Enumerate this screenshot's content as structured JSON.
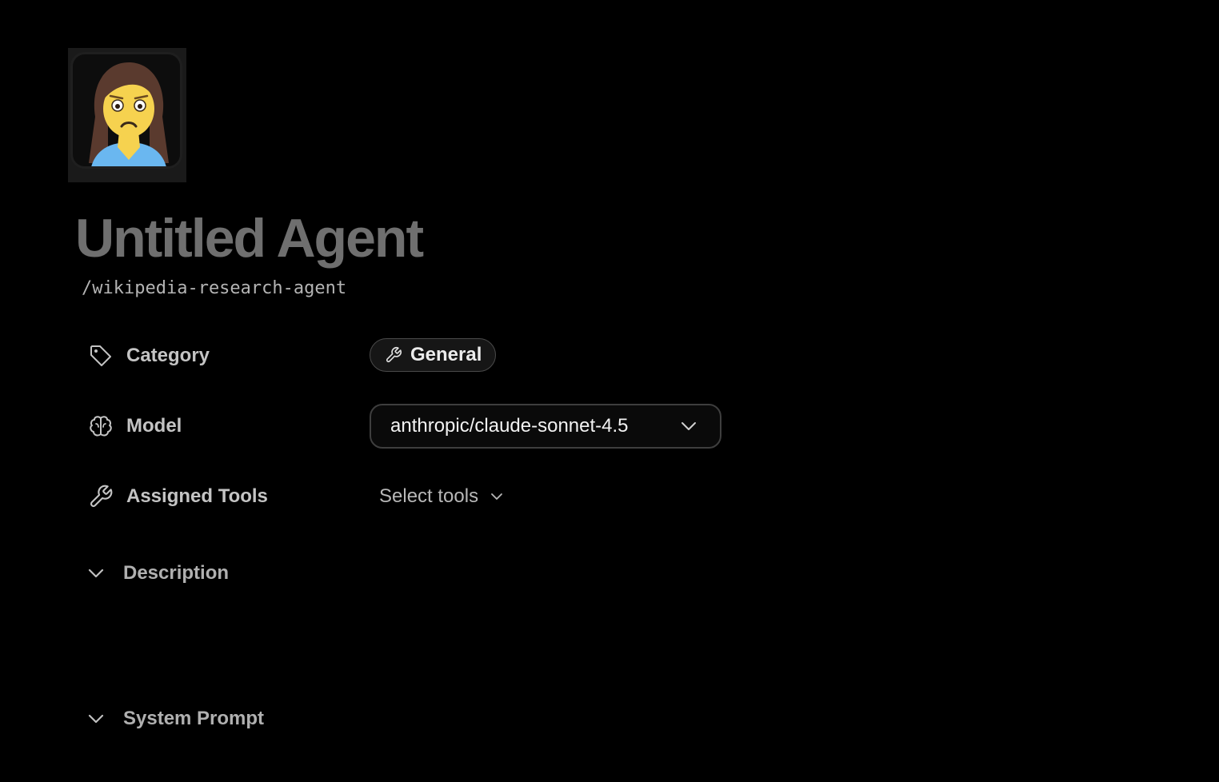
{
  "agent": {
    "name": "Untitled Agent",
    "slug": "/wikipedia-research-agent",
    "avatar_icon": "woman-worried-emoji"
  },
  "fields": {
    "category": {
      "label": "Category",
      "value": "General",
      "icon": "tag-icon",
      "value_icon": "wrench-icon"
    },
    "model": {
      "label": "Model",
      "value": "anthropic/claude-sonnet-4.5",
      "icon": "brain-icon"
    },
    "tools": {
      "label": "Assigned Tools",
      "value": "Select tools",
      "icon": "wrench-icon"
    }
  },
  "sections": {
    "description": {
      "label": "Description"
    },
    "system_prompt": {
      "label": "System Prompt"
    }
  },
  "colors": {
    "background": "#000000",
    "title": "#6f6f6f",
    "border": "#3e3e3e"
  }
}
